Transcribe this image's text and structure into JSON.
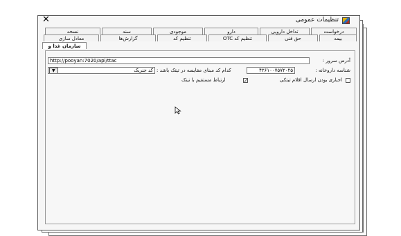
{
  "window": {
    "title": "تنظیمات عمومی",
    "close_glyph": "✕",
    "icon": "app-icon"
  },
  "tabs": {
    "row1": [
      "درخواست",
      "تداخل دارویی",
      "دارو",
      "موجودی",
      "سند",
      "نسخه"
    ],
    "row2": [
      "بیمه",
      "حق فنی",
      "تنظیم کد OTC",
      "تنظیم کد",
      "گزارش‌ها",
      "معادل سازی"
    ],
    "row3": [
      "سازمان غذا و دارو"
    ]
  },
  "form": {
    "server_address_label": "آدرس سرور :",
    "server_address_value": "http://pooyan:7020/api/ttac",
    "pharmacy_id_label": "شناسه داروخانه :",
    "pharmacy_id_value": "۴۲۶۱۰۰۷۵۷۲۰۲۵",
    "compare_code_label": "کدام کد مبنای مقایسه در تیتک باشد :",
    "compare_code_value": "کد جنریک",
    "dropdown_arrow": "▼",
    "mandatory_send_label": "اجباری بودن ارسال اقلام تیتکی",
    "mandatory_send_checked": false,
    "direct_link_label": "ارتباط مستقیم با تیتک",
    "direct_link_checked": true,
    "check_glyph": "✓"
  }
}
